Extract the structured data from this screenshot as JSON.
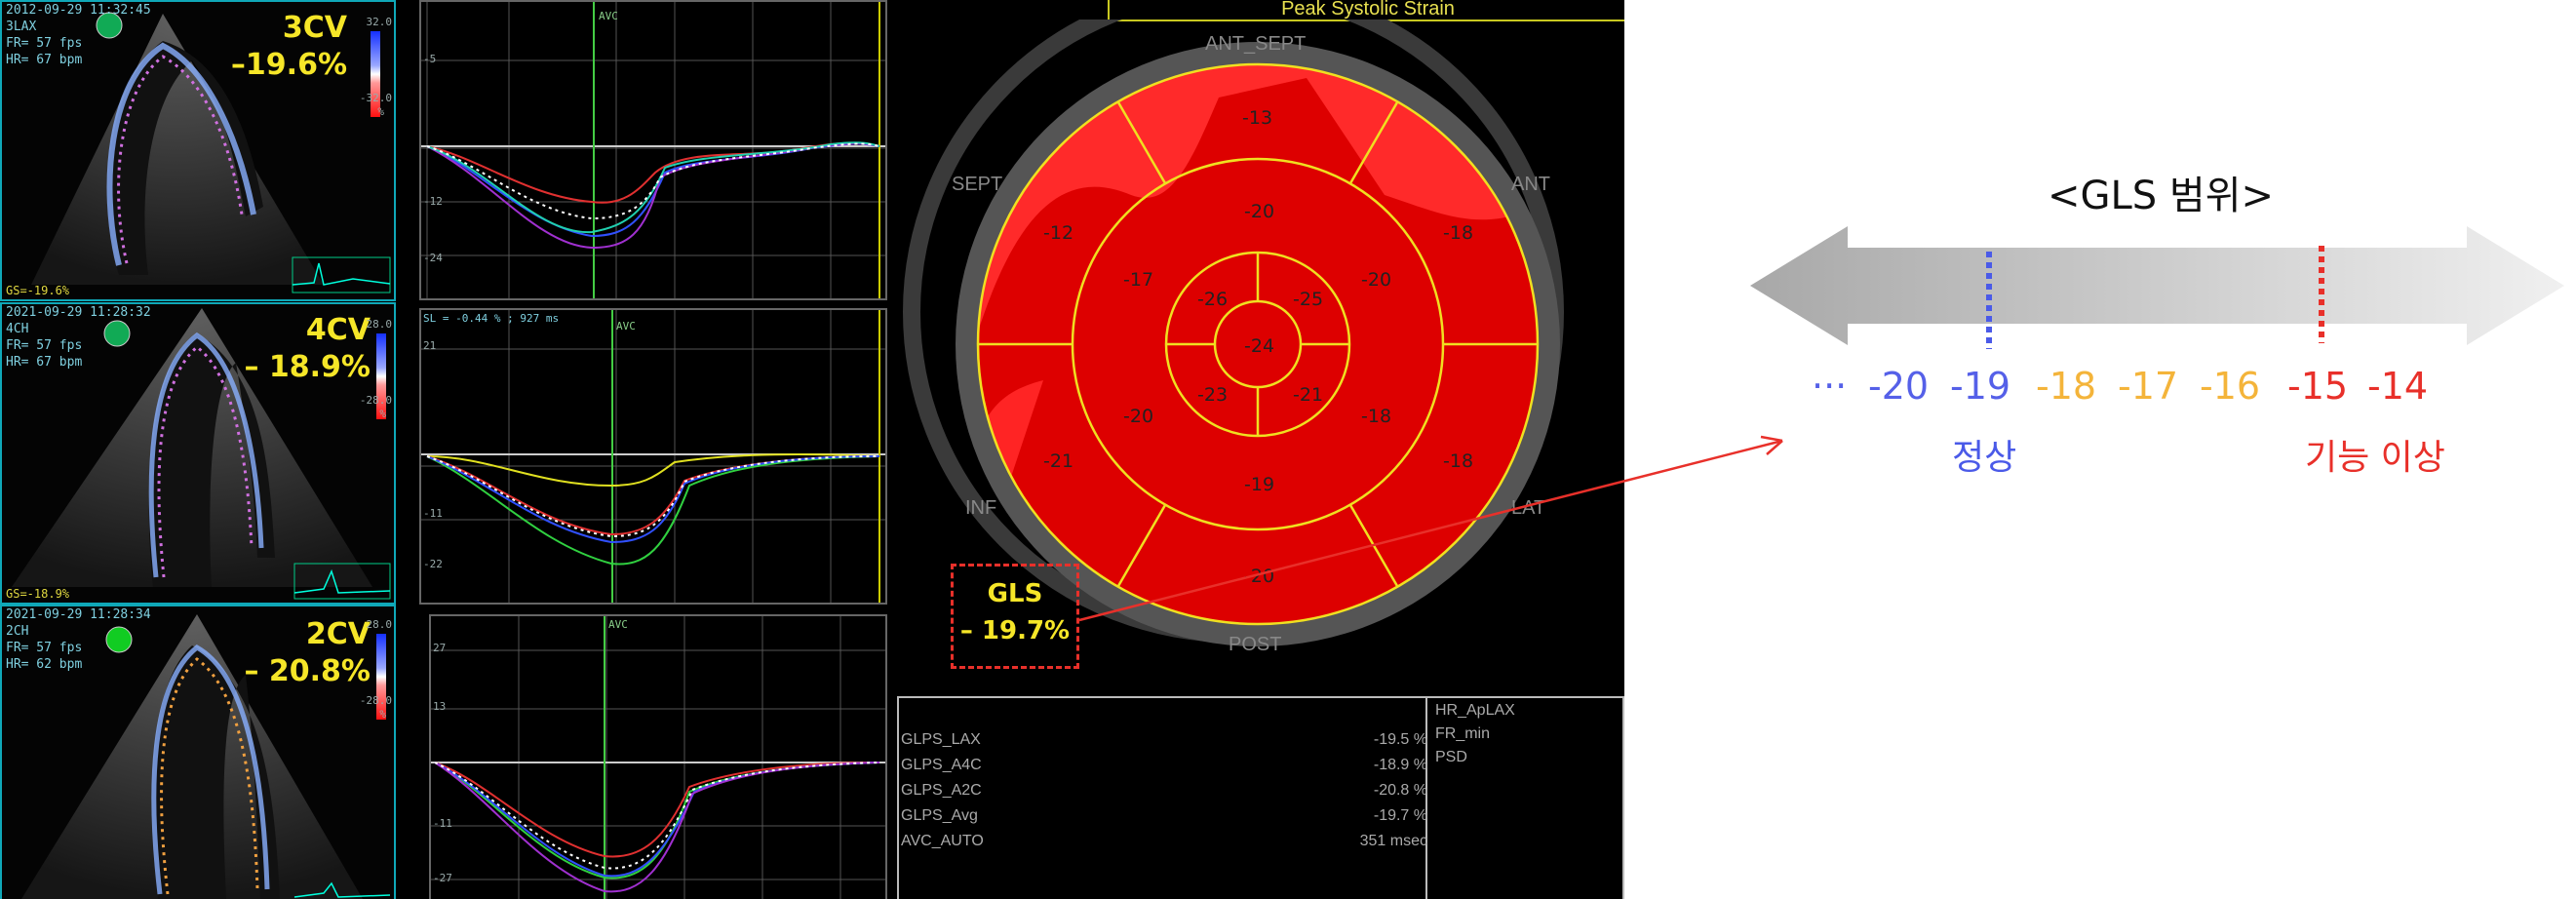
{
  "panels": [
    {
      "id": "3cv",
      "meta": "2012-09-29 11:32:45\n3LAX\nFR= 57 fps\nHR= 67 bpm",
      "view": "3CV",
      "value": "–19.6%",
      "foot": "GS=-19.6%",
      "cb_top": "32.0",
      "cb_mid": "-32.0",
      "cb_unit": "%"
    },
    {
      "id": "4cv",
      "meta": "2021-09-29 11:28:32\n4CH\nFR= 57 fps\nHR= 67 bpm",
      "view": "4CV",
      "value": "– 18.9%",
      "foot": "GS=-18.9%",
      "cb_top": "28.0",
      "cb_mid": "-28.0",
      "cb_unit": "%"
    },
    {
      "id": "2cv",
      "meta": "2021-09-29 11:28:34\n2CH\nFR= 57 fps\nHR= 62 bpm",
      "view": "2CV",
      "value": "– 20.8%",
      "foot": "",
      "cb_top": "28.0",
      "cb_mid": "-28.0",
      "cb_unit": "%"
    }
  ],
  "curves": {
    "avc_label": "AVC",
    "top_ticks": [
      "-5",
      "-12",
      "-24"
    ],
    "mid_header": "SL = -0.44 % ; 927 ms",
    "mid_ticks": [
      "21",
      "-11",
      "-22"
    ],
    "bot_ticks": [
      "27",
      "13",
      "-11",
      "-27"
    ]
  },
  "bullseye": {
    "title": "Peak Systolic Strain",
    "walls": {
      "ant_sept": "ANT_SEPT",
      "ant": "ANT",
      "sept": "SEPT",
      "inf": "INF",
      "lat": "LAT",
      "post": "POST"
    },
    "segments": {
      "basal": [
        "-13",
        "-18",
        "-18",
        "-20",
        "-21",
        "-12"
      ],
      "mid": [
        "-20",
        "-20",
        "-18",
        "-19",
        "-20",
        "-17"
      ],
      "apical": [
        "-25",
        "-21",
        "-23",
        "-26"
      ],
      "apex": "-24"
    },
    "gls_label": "GLS",
    "gls_value": "– 19.7%"
  },
  "stats": {
    "rows": [
      {
        "label": "GLPS_LAX",
        "value": "-19.5 %"
      },
      {
        "label": "GLPS_A4C",
        "value": "-18.9 %"
      },
      {
        "label": "GLPS_A2C",
        "value": "-20.8 %"
      },
      {
        "label": "GLPS_Avg",
        "value": "-19.7 %"
      },
      {
        "label": "AVC_AUTO",
        "value": "351 msec"
      }
    ],
    "side": [
      "HR_ApLAX",
      "FR_min",
      "PSD"
    ]
  },
  "scale": {
    "title": "<GLS 범위>",
    "numbers": [
      {
        "text": "···",
        "color": "#5560e8"
      },
      {
        "text": "-20",
        "color": "#5560e8"
      },
      {
        "text": "-19",
        "color": "#5560e8"
      },
      {
        "text": "-18",
        "color": "#f4b43a"
      },
      {
        "text": "-17",
        "color": "#f4b43a"
      },
      {
        "text": "-16",
        "color": "#f4b43a"
      },
      {
        "text": "-15",
        "color": "#e8302a"
      },
      {
        "text": "-14",
        "color": "#e8302a"
      }
    ],
    "normal_label": "정상",
    "abnormal_label": "기능 이상",
    "colors": {
      "normal": "#4a5ae8",
      "abnormal": "#e8302a",
      "arrow": "#e8302a"
    }
  }
}
